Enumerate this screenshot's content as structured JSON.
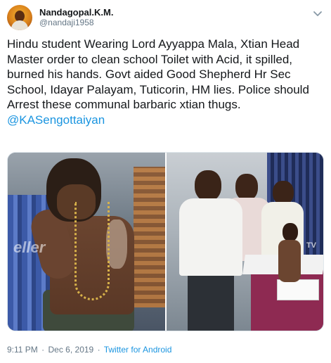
{
  "author": {
    "display_name": "Nandagopal.K.M.",
    "handle": "@nandaji1958"
  },
  "tweet": {
    "text": "Hindu student Wearing Lord Ayyappa Mala, Xtian Head Master order to clean school Toilet with Acid, it spilled, burned his hands. Govt aided Good Shepherd Hr Sec School, Idayar Palayam, Tuticorin, HM lies. Police should Arrest these communal barbaric xtian thugs.",
    "mention": "@KASengottaiyan"
  },
  "media": {
    "left_watermark": "eller",
    "right_watermark": "TV"
  },
  "meta": {
    "time": "9:11 PM",
    "separator_1": "·",
    "date": "Dec 6, 2019",
    "separator_2": "·",
    "source": "Twitter for Android"
  },
  "icons": {
    "caret": "chevron-down-icon",
    "avatar": "avatar"
  },
  "colors": {
    "link": "#1b95e0",
    "secondary_text": "#657786",
    "primary_text": "#14171a"
  }
}
